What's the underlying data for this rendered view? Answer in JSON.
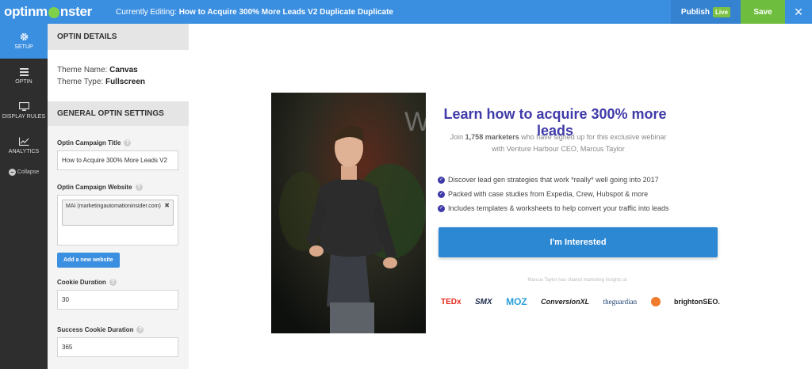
{
  "topbar": {
    "logo_left": "optinm",
    "logo_right": "nster",
    "editing_label": "Currently Editing:",
    "editing_title": "How to Acquire 300% More Leads V2 Duplicate Duplicate",
    "publish_label": "Publish",
    "live_badge": "Live",
    "save_label": "Save",
    "close_icon": "×"
  },
  "rail": {
    "items": [
      {
        "label": "SETUP",
        "icon": "gear-icon"
      },
      {
        "label": "OPTIN",
        "icon": "menu-icon"
      },
      {
        "label": "DISPLAY RULES",
        "icon": "monitor-icon"
      },
      {
        "label": "ANALYTICS",
        "icon": "chart-icon"
      }
    ],
    "collapse_label": "Collapse"
  },
  "panel": {
    "optin_details_header": "OPTIN DETAILS",
    "theme_name_label": "Theme Name:",
    "theme_name_value": "Canvas",
    "theme_type_label": "Theme Type:",
    "theme_type_value": "Fullscreen",
    "general_header": "GENERAL OPTIN SETTINGS",
    "campaign_title_label": "Optin Campaign Title",
    "campaign_title_value": "How to Acquire 300% More Leads V2",
    "campaign_website_label": "Optin Campaign Website",
    "website_tag": "MAI (marketingautomationinsider.com)",
    "add_website_label": "Add a new website",
    "cookie_duration_label": "Cookie Duration",
    "cookie_duration_value": "30",
    "success_cookie_label": "Success Cookie Duration",
    "success_cookie_value": "365"
  },
  "preview": {
    "headline": "Learn how to acquire 300% more leads",
    "sub_pre": "Join",
    "sub_bold": "1,758 marketers",
    "sub_post": "who have signed up for this exclusive webinar",
    "sub_line2": "with Venture Harbour CEO, Marcus Taylor",
    "bullets": [
      "Discover lead gen strategies that work *really* well going into 2017",
      "Packed with case studies from Expedia, Crew, Hubspot & more",
      "Includes templates & worksheets to help convert your traffic into leads"
    ],
    "cta_label": "I'm Interested",
    "shared_text": "Marcus Taylor has shared marketing insights at",
    "logos": [
      "TEDx",
      "SMX",
      "MOZ",
      "ConversionXL",
      "theguardian",
      "brightonSEO."
    ]
  },
  "colors": {
    "topbar": "#3b8fe0",
    "save": "#6fbd3f",
    "headline": "#3f3aa8",
    "cta": "#2d88d4"
  }
}
